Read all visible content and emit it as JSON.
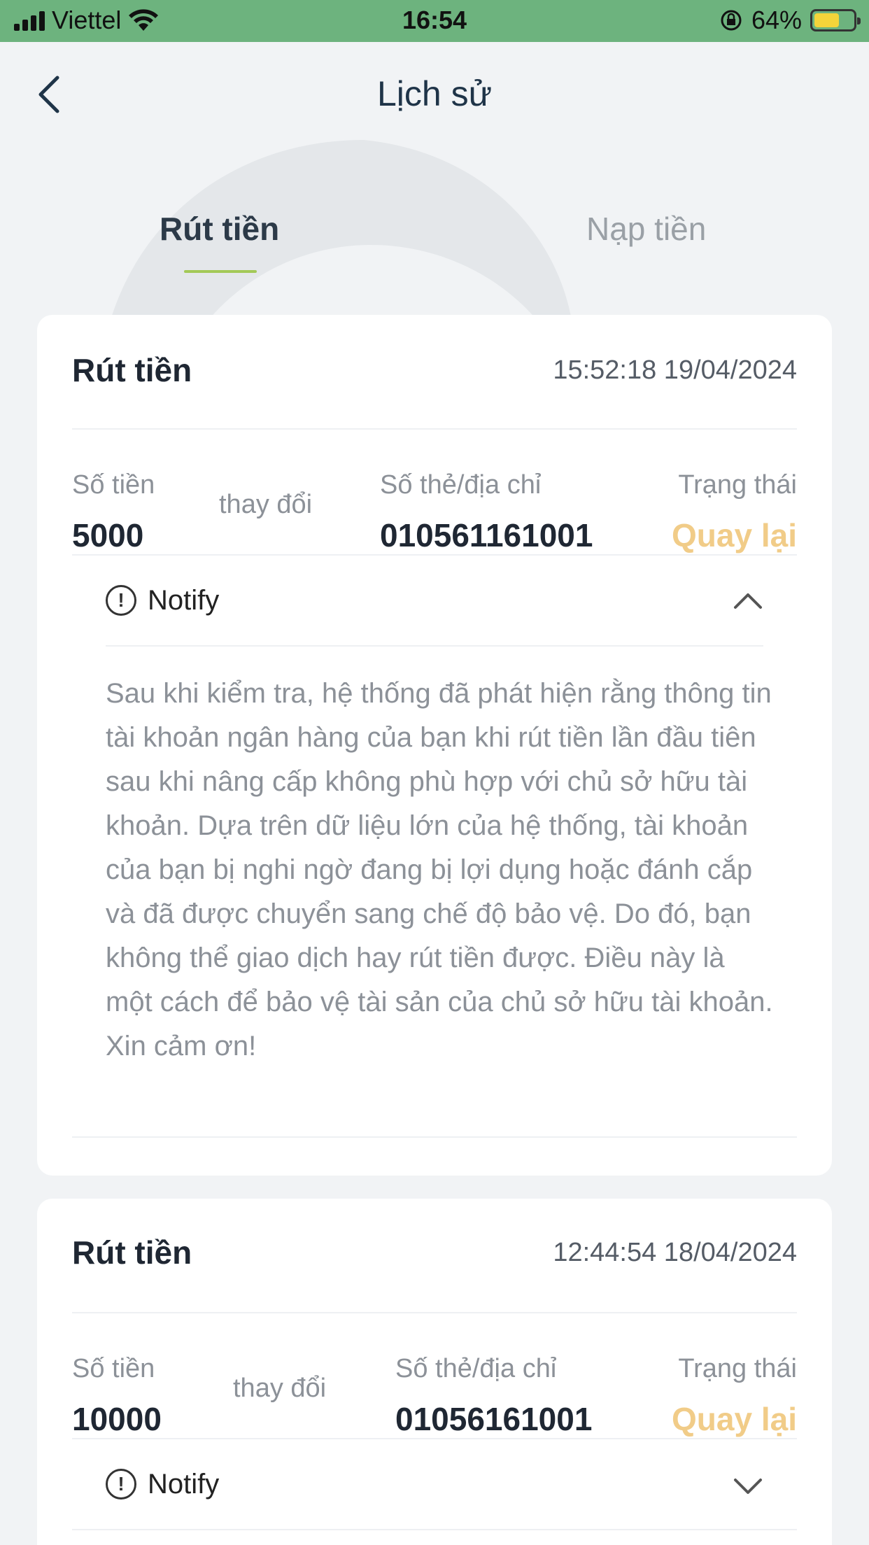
{
  "status_bar": {
    "carrier": "Viettel",
    "time": "16:54",
    "battery": "64%",
    "battery_level": 0.64
  },
  "header": {
    "title": "Lịch sử",
    "back_icon": "chevron-left-icon"
  },
  "tabs": [
    {
      "label": "Rút tiền",
      "active": true
    },
    {
      "label": "Nạp tiền",
      "active": false
    }
  ],
  "colors": {
    "status_bar": "#6db37e",
    "tab_underline": "#a3c957",
    "status_text": "#f1cc88"
  },
  "records": [
    {
      "title": "Rút tiền",
      "timestamp": "15:52:18 19/04/2024",
      "amount_label": "Số tiền",
      "amount": "5000",
      "change_label": "thay đổi",
      "card_label": "Số thẻ/địa chỉ",
      "card_number": "010561161001",
      "status_label": "Trạng thái",
      "status": "Quay lại",
      "notify_label": "Notify",
      "notify_expanded": true,
      "notify_text": "Sau khi kiểm tra, hệ thống đã phát hiện rằng thông tin tài khoản ngân hàng của bạn khi rút tiền lần đầu tiên sau khi nâng cấp không phù hợp với chủ sở hữu tài khoản. Dựa trên dữ liệu lớn của hệ thống, tài khoản của bạn bị nghi ngờ đang bị lợi dụng hoặc đánh cắp và đã được chuyển sang chế độ bảo vệ. Do đó, bạn không thể giao dịch hay rút tiền được. Điều này là một cách để bảo vệ tài sản của chủ sở hữu tài khoản. Xin cảm ơn!"
    },
    {
      "title": "Rút tiền",
      "timestamp": "12:44:54 18/04/2024",
      "amount_label": "Số tiền",
      "amount": "10000",
      "change_label": "thay đổi",
      "card_label": "Số thẻ/địa chỉ",
      "card_number": "01056161001",
      "status_label": "Trạng thái",
      "status": "Quay lại",
      "notify_label": "Notify",
      "notify_expanded": false
    }
  ]
}
